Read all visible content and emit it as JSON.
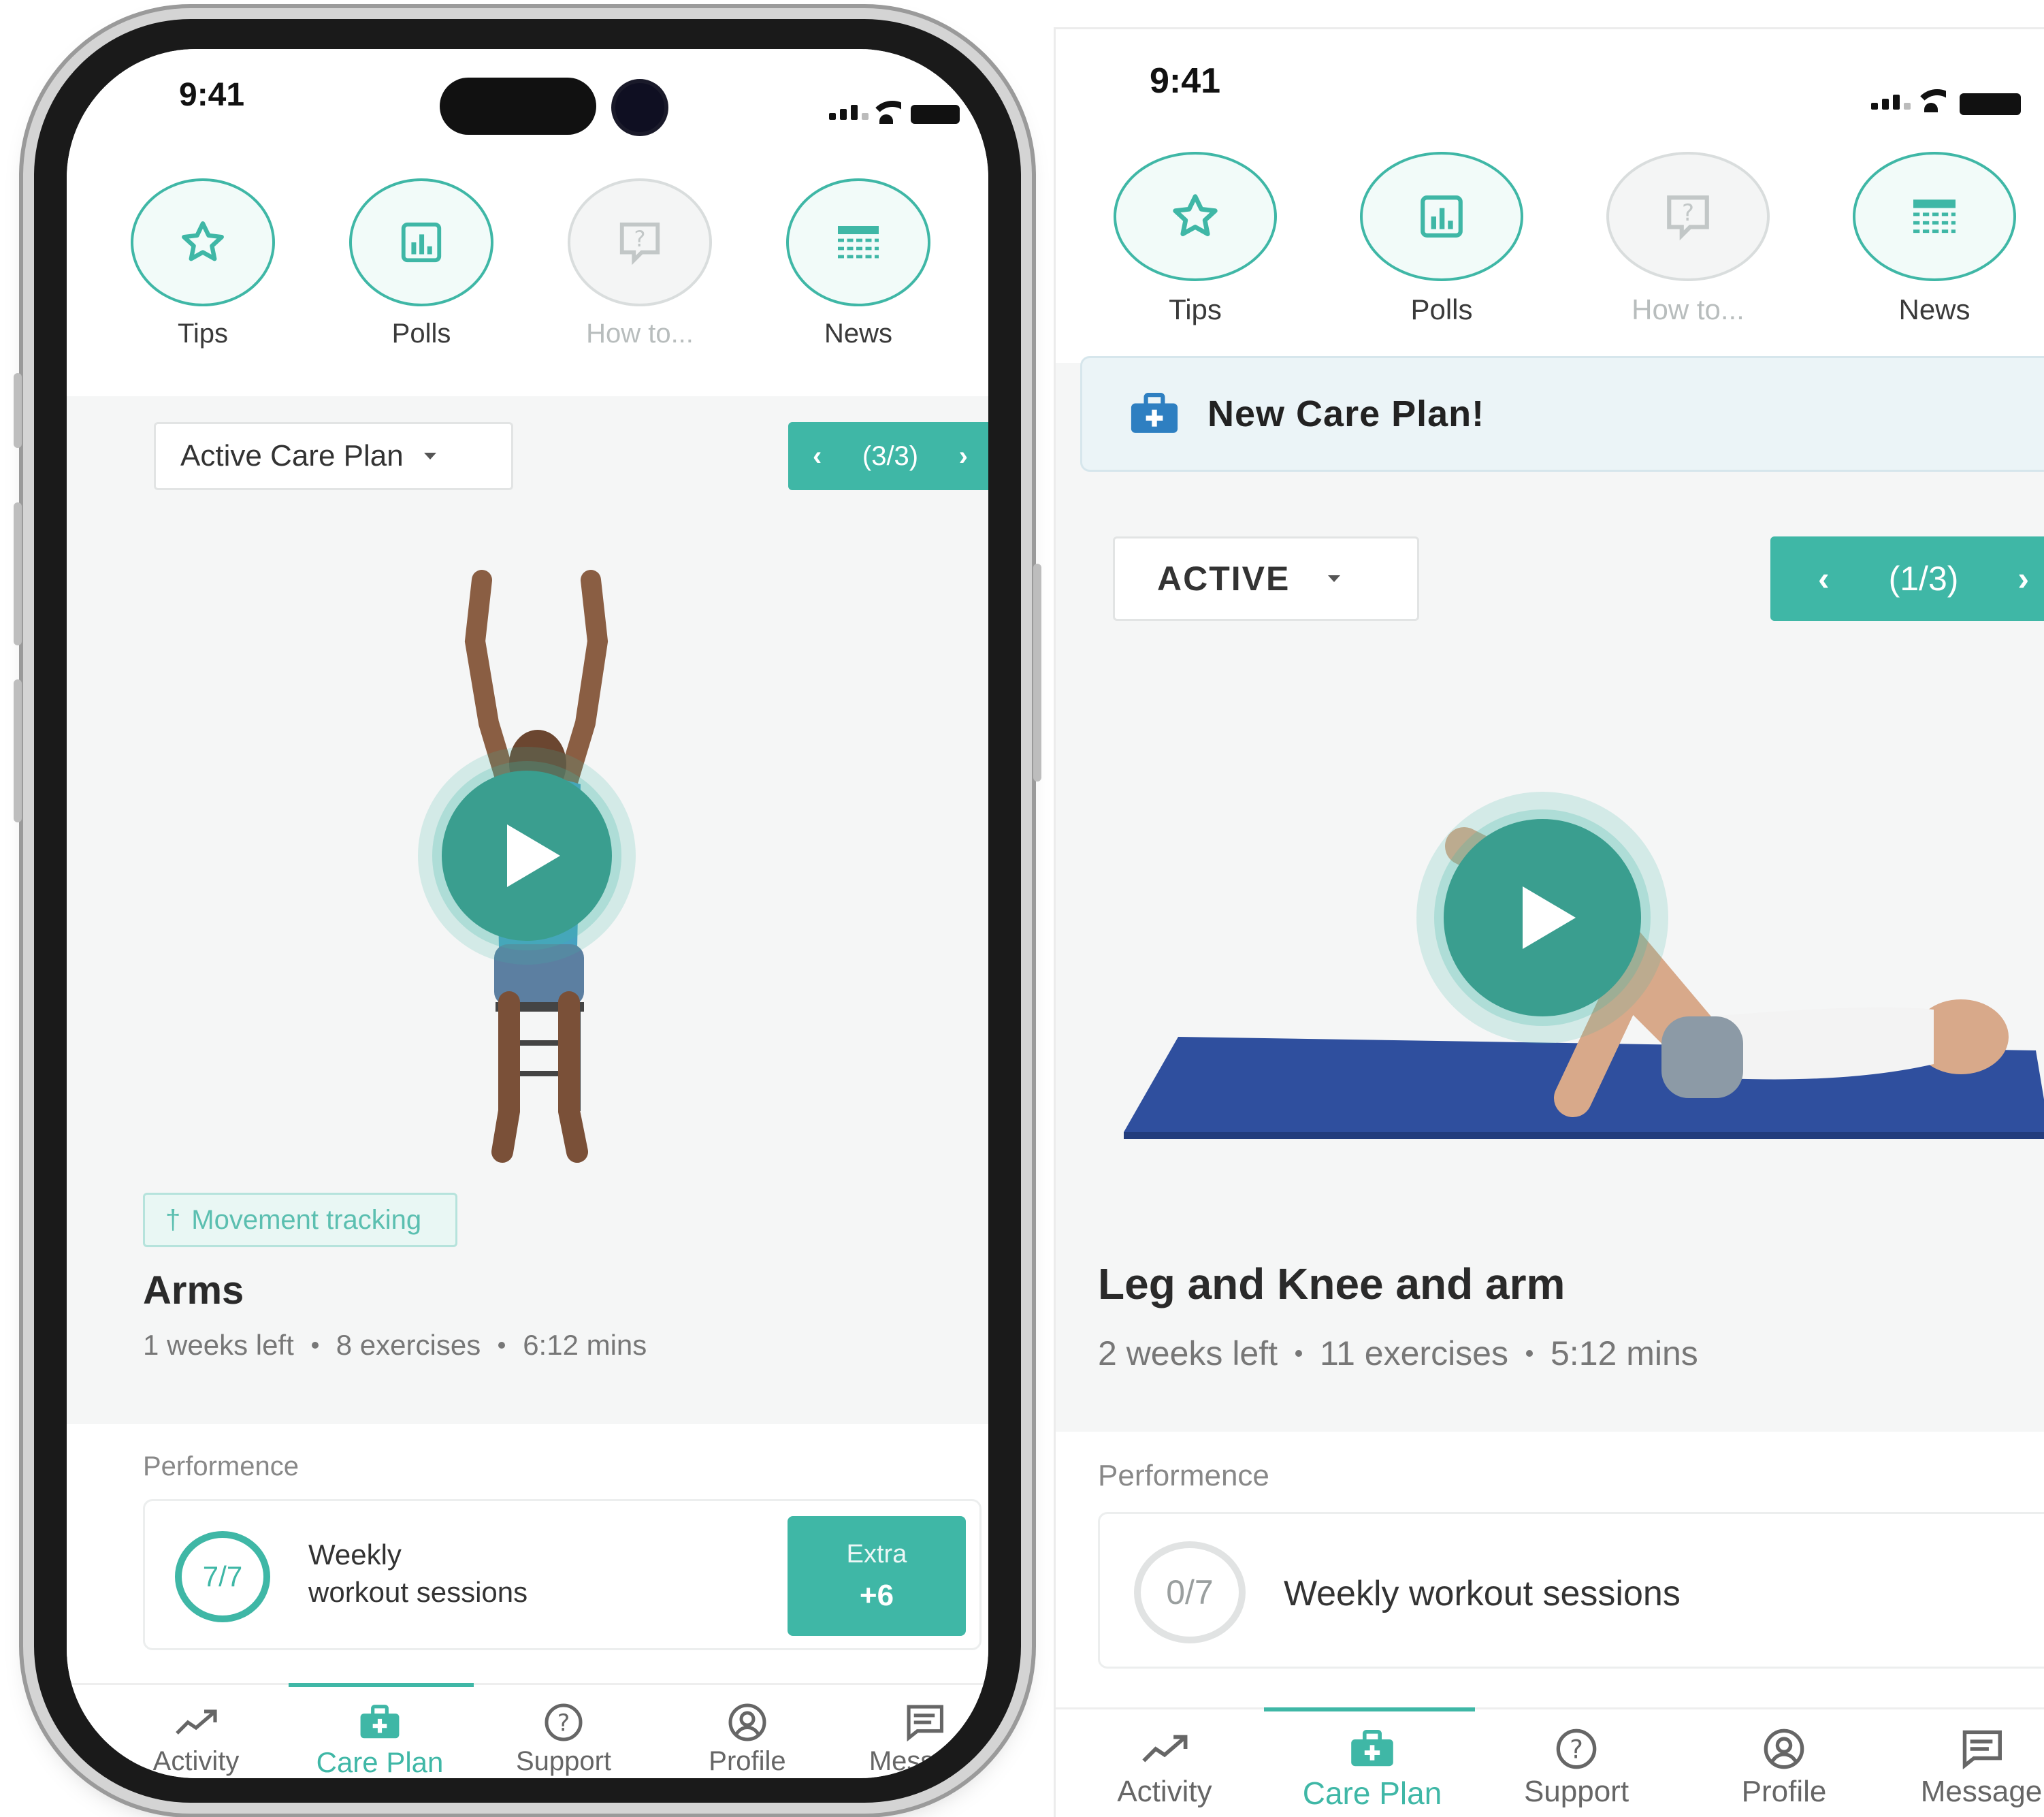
{
  "status": {
    "time": "9:41"
  },
  "quick_actions": [
    {
      "label": "Tips",
      "icon": "star-icon",
      "enabled": true
    },
    {
      "label": "Polls",
      "icon": "chart-icon",
      "enabled": true
    },
    {
      "label": "How to...",
      "icon": "help-bubble-icon",
      "enabled": false
    },
    {
      "label": "News",
      "icon": "newspaper-icon",
      "enabled": true
    }
  ],
  "left": {
    "plan_dropdown": "Active Care Plan",
    "pager": "(3/3)",
    "tag": "Movement tracking",
    "workout_title": "Arms",
    "meta": [
      "1 weeks left",
      "8 exercises",
      "6:12 mins"
    ],
    "performance_label": "Performence",
    "sessions_count": "7/7",
    "sessions_fraction": 1.0,
    "sessions_text_1": "Weekly",
    "sessions_text_2": "workout sessions",
    "extra_label": "Extra",
    "extra_value": "+6"
  },
  "right": {
    "banner": "New Care Plan!",
    "plan_dropdown": "ACTIVE",
    "pager": "(1/3)",
    "workout_title": "Leg and Knee and arm",
    "meta": [
      "2 weeks left",
      "11 exercises",
      "5:12 mins"
    ],
    "performance_label": "Performence",
    "sessions_count": "0/7",
    "sessions_fraction": 0.0,
    "sessions_text": "Weekly workout sessions"
  },
  "tabs": [
    {
      "label": "Activity",
      "icon": "trend-icon"
    },
    {
      "label": "Care Plan",
      "icon": "medkit-icon",
      "active": true
    },
    {
      "label": "Support",
      "icon": "question-circle-icon"
    },
    {
      "label": "Profile",
      "icon": "user-circle-icon"
    },
    {
      "label": "Message",
      "icon": "message-icon"
    }
  ],
  "colors": {
    "accent": "#3fb7a6",
    "accent_dark": "#3a9e8f",
    "banner_bg": "#ebf4f7"
  }
}
